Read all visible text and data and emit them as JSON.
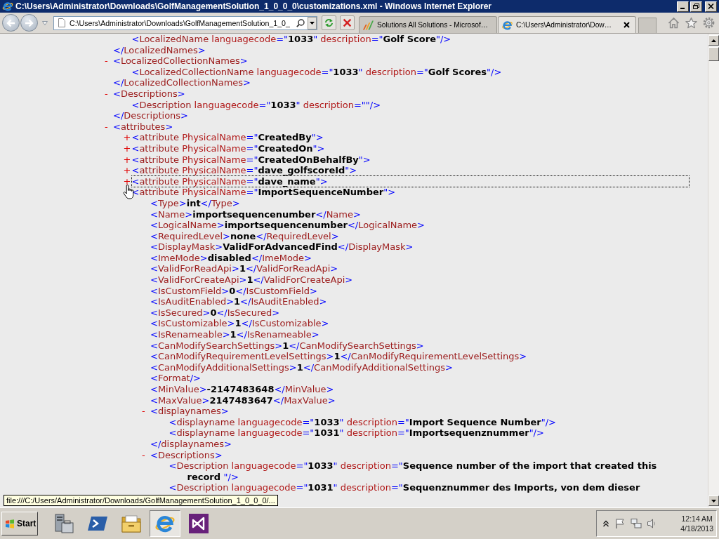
{
  "window": {
    "title": "C:\\Users\\Administrator\\Downloads\\GolfManagementSolution_1_0_0_0\\customizations.xml - Windows Internet Explorer"
  },
  "address_bar": {
    "value": "C:\\Users\\Administrator\\Downloads\\GolfManagementSolution_1_0_"
  },
  "tabs": [
    {
      "kind": "dynamics",
      "label": "Solutions All Solutions - Microsof…",
      "selected": false
    },
    {
      "kind": "ie",
      "label": "C:\\Users\\Administrator\\Dow…",
      "selected": true
    }
  ],
  "xml_view": {
    "nodes": [
      {
        "children": [
          {
            "tag": "<LocalizedName languagecode=\"1033\" description=\"Golf Score\"/>"
          }
        ],
        "close": "</LocalizedNames>"
      },
      {
        "toggle": "-",
        "tag": "<LocalizedCollectionNames>",
        "children": [
          {
            "tag": "<LocalizedCollectionName languagecode=\"1033\" description=\"Golf Scores\"/>"
          }
        ],
        "close": "</LocalizedCollectionNames>"
      },
      {
        "toggle": "-",
        "tag": "<Descriptions>",
        "children": [
          {
            "tag": "<Description languagecode=\"1033\" description=\"\"/>"
          }
        ],
        "close": "</Descriptions>"
      },
      {
        "toggle": "-",
        "tag": "<attributes>",
        "children": [
          {
            "toggle": "+",
            "tag": "<attribute PhysicalName=\"CreatedBy\">",
            "focused": false,
            "hovered": false
          },
          {
            "toggle": "+",
            "tag": "<attribute PhysicalName=\"CreatedOn\">",
            "focused": false,
            "hovered": false
          },
          {
            "toggle": "+",
            "tag": "<attribute PhysicalName=\"CreatedOnBehalfBy\">",
            "focused": false,
            "hovered": false
          },
          {
            "toggle": "+",
            "tag": "<attribute PhysicalName=\"dave_golfscoreId\">",
            "focused": false,
            "hovered": false
          },
          {
            "toggle": "+",
            "tag": "<attribute PhysicalName=\"dave_name\">",
            "focused": true,
            "hovered": false
          },
          {
            "tag": "<attribute PhysicalName=\"ImportSequenceNumber\">",
            "focused": false,
            "hovered": true,
            "children": [
              {
                "tag": "<Type>int</Type>"
              },
              {
                "tag": "<Name>importsequencenumber</Name>"
              },
              {
                "tag": "<LogicalName>importsequencenumber</LogicalName>"
              },
              {
                "tag": "<RequiredLevel>none</RequiredLevel>"
              },
              {
                "tag": "<DisplayMask>ValidForAdvancedFind</DisplayMask>"
              },
              {
                "tag": "<ImeMode>disabled</ImeMode>"
              },
              {
                "tag": "<ValidForReadApi>1</ValidForReadApi>"
              },
              {
                "tag": "<ValidForCreateApi>1</ValidForCreateApi>"
              },
              {
                "tag": "<IsCustomField>0</IsCustomField>"
              },
              {
                "tag": "<IsAuditEnabled>1</IsAuditEnabled>"
              },
              {
                "tag": "<IsSecured>0</IsSecured>"
              },
              {
                "tag": "<IsCustomizable>1</IsCustomizable>"
              },
              {
                "tag": "<IsRenameable>1</IsRenameable>"
              },
              {
                "tag": "<CanModifySearchSettings>1</CanModifySearchSettings>"
              },
              {
                "tag": "<CanModifyRequirementLevelSettings>1</CanModifyRequirementLevelSettings>"
              },
              {
                "tag": "<CanModifyAdditionalSettings>1</CanModifyAdditionalSettings>"
              },
              {
                "tag": "<Format/>"
              },
              {
                "tag": "<MinValue>-2147483648</MinValue>"
              },
              {
                "tag": "<MaxValue>2147483647</MaxValue>"
              },
              {
                "toggle": "-",
                "tag": "<displaynames>",
                "children": [
                  {
                    "tag": "<displayname languagecode=\"1033\" description=\"Import Sequence Number\"/>"
                  },
                  {
                    "tag": "<displayname languagecode=\"1031\" description=\"Importsequenznummer\"/>"
                  }
                ],
                "close": "</displaynames>"
              },
              {
                "toggle": "-",
                "tag": "<Descriptions>",
                "children": [
                  {
                    "tag": "<Description languagecode=\"1033\" description=\"Sequence number of the import that created this record \"/>"
                  },
                  {
                    "tag": "<Description languagecode=\"1031\" description=\"Sequenznummer des Imports, von dem dieser"
                  }
                ]
              }
            ]
          }
        ]
      }
    ]
  },
  "status_tooltip": "file:///C:/Users/Administrator/Downloads/GolfManagementSolution_1_0_0_0/...",
  "taskbar": {
    "start": "Start",
    "apps": [
      {
        "kind": "server",
        "selected": false
      },
      {
        "kind": "shell",
        "selected": false
      },
      {
        "kind": "folder",
        "selected": false
      },
      {
        "kind": "ie",
        "selected": true
      },
      {
        "kind": "vs",
        "selected": false
      }
    ],
    "clock": {
      "time": "12:14 AM",
      "date": "4/18/2013"
    }
  }
}
